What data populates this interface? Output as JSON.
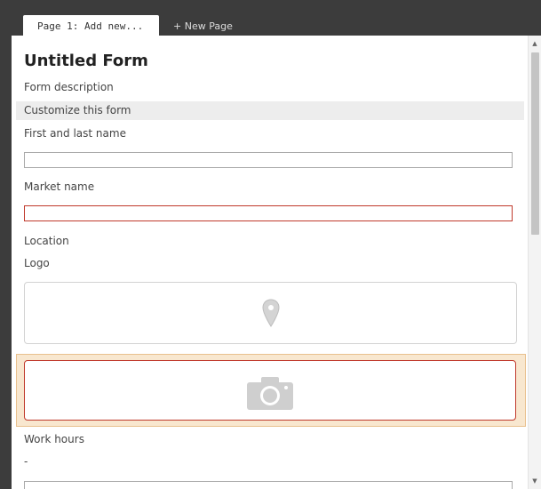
{
  "tabs": {
    "active_label": "Page 1: Add new...",
    "new_page_label": "+ New Page"
  },
  "form": {
    "title": "Untitled Form",
    "description": "Form description",
    "customize_label": "Customize this form",
    "fields": {
      "name_label": "First and last name",
      "name_value": "",
      "market_label": "Market name",
      "market_value": "",
      "location_label": "Location",
      "logo_label": "Logo",
      "work_hours_label": "Work hours",
      "work_hours_value": "-"
    }
  },
  "colors": {
    "error_border": "#c0392b",
    "selection_fill": "#f8e7cf",
    "icon_gray": "#c9c9c9"
  },
  "icons": [
    "map-pin-icon",
    "camera-icon",
    "scroll-up-icon",
    "scroll-down-icon"
  ]
}
